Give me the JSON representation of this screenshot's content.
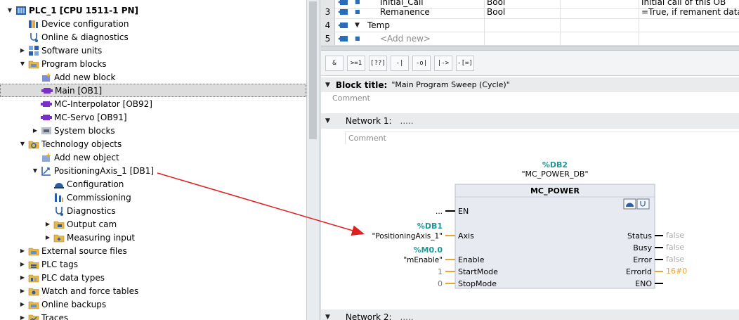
{
  "tree": {
    "items": [
      {
        "label": "PLC_1 [CPU 1511-1 PN]",
        "icon": "plc-icon",
        "expanded": true,
        "bold": true
      },
      {
        "label": "Device configuration",
        "icon": "device-config-icon"
      },
      {
        "label": "Online & diagnostics",
        "icon": "online-diagnostics-icon"
      },
      {
        "label": "Software units",
        "icon": "software-units-icon",
        "expanded": false
      },
      {
        "label": "Program blocks",
        "icon": "folder-icon",
        "expanded": true
      },
      {
        "label": "Add new block",
        "icon": "add-block-icon"
      },
      {
        "label": "Main [OB1]",
        "icon": "ob-block-icon",
        "selected": true
      },
      {
        "label": "MC-Interpolator [OB92]",
        "icon": "ob-block-icon"
      },
      {
        "label": "MC-Servo [OB91]",
        "icon": "ob-block-icon"
      },
      {
        "label": "System blocks",
        "icon": "system-blocks-icon",
        "expanded": false
      },
      {
        "label": "Technology objects",
        "icon": "technology-folder-icon",
        "expanded": true
      },
      {
        "label": "Add new object",
        "icon": "add-object-icon"
      },
      {
        "label": "PositioningAxis_1 [DB1]",
        "icon": "positioning-axis-icon",
        "expanded": true
      },
      {
        "label": "Configuration",
        "icon": "configuration-icon"
      },
      {
        "label": "Commissioning",
        "icon": "commissioning-icon"
      },
      {
        "label": "Diagnostics",
        "icon": "diagnostics-icon"
      },
      {
        "label": "Output cam",
        "icon": "output-cam-icon",
        "expanded": false
      },
      {
        "label": "Measuring input",
        "icon": "measuring-input-icon",
        "expanded": false
      },
      {
        "label": "External source files",
        "icon": "folder-icon",
        "expanded": false
      },
      {
        "label": "PLC tags",
        "icon": "plc-tags-icon",
        "expanded": false
      },
      {
        "label": "PLC data types",
        "icon": "plc-data-types-icon",
        "expanded": false
      },
      {
        "label": "Watch and force tables",
        "icon": "watch-tables-icon",
        "expanded": false
      },
      {
        "label": "Online backups",
        "icon": "folder-icon",
        "expanded": false
      },
      {
        "label": "Traces",
        "icon": "traces-icon",
        "expanded": false
      }
    ]
  },
  "interface": {
    "rows": [
      {
        "num": "",
        "name": "Initial_Call",
        "type": "Bool",
        "comment": "Initial call of this OB"
      },
      {
        "num": "3",
        "name": "Remanence",
        "type": "Bool",
        "comment": "=True, if remanent data a"
      },
      {
        "num": "4",
        "name": "Temp",
        "type": "",
        "comment": ""
      },
      {
        "num": "5",
        "name": "<Add new>",
        "type": "",
        "comment": ""
      }
    ]
  },
  "toolbar": {
    "buttons": [
      "&",
      ">=1",
      "[??]",
      "-|",
      "-o|",
      "|->",
      "-[=]"
    ]
  },
  "block": {
    "title_label": "Block title:",
    "title_value": "\"Main Program Sweep (Cycle)\"",
    "comment": "Comment"
  },
  "network1": {
    "title_label": "Network 1:",
    "title_value": ".....",
    "comment": "Comment"
  },
  "network2": {
    "title_label": "Network 2:",
    "title_value": "....."
  },
  "fb": {
    "db_address": "%DB2",
    "db_name": "\"MC_POWER_DB\"",
    "name": "MC_POWER",
    "inputs": [
      {
        "pin": "EN",
        "address": "",
        "name": "...",
        "literal": ""
      },
      {
        "pin": "Axis",
        "address": "%DB1",
        "name": "\"PositioningAxis_1\"",
        "literal": ""
      },
      {
        "pin": "Enable",
        "address": "%M0.0",
        "name": "\"mEnable\"",
        "literal": ""
      },
      {
        "pin": "StartMode",
        "address": "",
        "name": "",
        "literal": "1"
      },
      {
        "pin": "StopMode",
        "address": "",
        "name": "",
        "literal": "0"
      }
    ],
    "outputs": [
      {
        "pin": "Status",
        "value": "false"
      },
      {
        "pin": "Busy",
        "value": "false"
      },
      {
        "pin": "Error",
        "value": "false"
      },
      {
        "pin": "ErrorId",
        "value": "16#0"
      },
      {
        "pin": "ENO",
        "value": ""
      }
    ]
  },
  "colors": {
    "accent_teal": "#1a9a98",
    "pin_orange": "#e8a33c",
    "arrow_red": "#e02020",
    "fb_fill": "#e8eaf2"
  }
}
